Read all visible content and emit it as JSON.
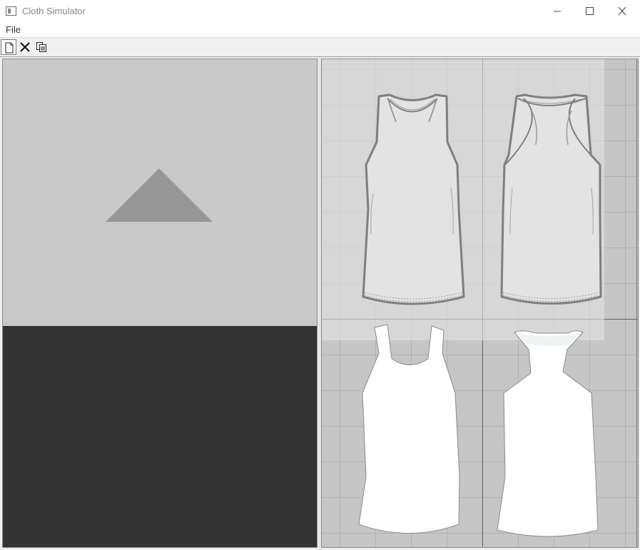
{
  "window": {
    "title": "Cloth Simulator"
  },
  "menu": {
    "file_label": "File"
  },
  "toolbar": {
    "buttons": [
      "new-icon",
      "close-icon",
      "copy-icon"
    ]
  },
  "colors": {
    "sky": "#c9c9c9",
    "ground": "#333333",
    "pattern_background": "#c6c6c6",
    "reference_overlay": "#d9d9d9",
    "garment_outline": "#7f7f7f",
    "cloth_piece_fill": "#ffffff"
  },
  "viewports": {
    "simulation": {
      "object": "cloth-triangle-icon"
    },
    "pattern": {
      "reference": [
        "tank-top-front",
        "tank-top-back"
      ],
      "pieces": [
        "front-piece",
        "back-piece"
      ]
    }
  }
}
